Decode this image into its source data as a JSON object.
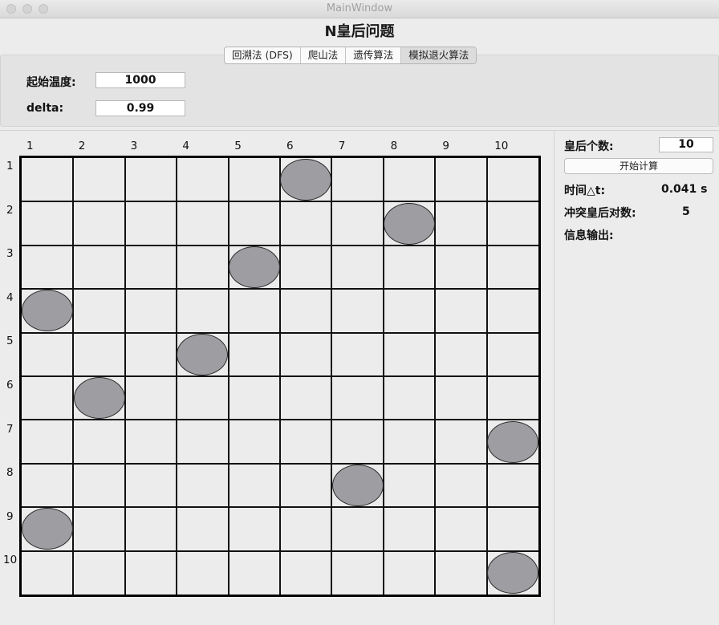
{
  "window": {
    "title": "MainWindow"
  },
  "app": {
    "title": "N皇后问题"
  },
  "tabs": [
    {
      "label": "回溯法 (DFS)",
      "active": false
    },
    {
      "label": "爬山法",
      "active": false
    },
    {
      "label": "遗传算法",
      "active": false
    },
    {
      "label": "模拟退火算法",
      "active": true
    }
  ],
  "params": {
    "start_temp_label": "起始温度:",
    "start_temp_value": "1000",
    "delta_label": "delta:",
    "delta_value": "0.99"
  },
  "board": {
    "size": 10,
    "col_labels": [
      "1",
      "2",
      "3",
      "4",
      "5",
      "6",
      "7",
      "8",
      "9",
      "10"
    ],
    "row_labels": [
      "1",
      "2",
      "3",
      "4",
      "5",
      "6",
      "7",
      "8",
      "9",
      "10"
    ],
    "queens": [
      {
        "row": 1,
        "col": 6
      },
      {
        "row": 2,
        "col": 8
      },
      {
        "row": 3,
        "col": 5
      },
      {
        "row": 4,
        "col": 1
      },
      {
        "row": 5,
        "col": 4
      },
      {
        "row": 6,
        "col": 2
      },
      {
        "row": 7,
        "col": 10
      },
      {
        "row": 8,
        "col": 7
      },
      {
        "row": 9,
        "col": 1
      },
      {
        "row": 10,
        "col": 10
      }
    ]
  },
  "right_panel": {
    "queen_count_label": "皇后个数:",
    "queen_count_value": "10",
    "start_button": "开始计算",
    "time_label": "时间△t:",
    "time_value": "0.041 s",
    "conflict_label": "冲突皇后对数:",
    "conflict_value": "5",
    "info_label": "信息输出:"
  },
  "colors": {
    "queen_fill": "#9e9da2",
    "background": "#ececec"
  }
}
